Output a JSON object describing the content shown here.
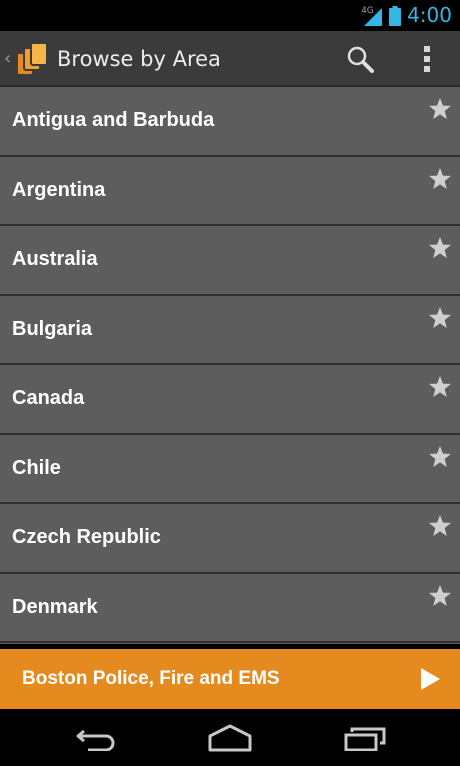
{
  "status_bar": {
    "network_type": "4G",
    "time": "4:00",
    "signal_icon": "signal-icon",
    "battery_icon": "battery-icon"
  },
  "action_bar": {
    "up_icon": "back-caret-icon",
    "app_icon": "app-logo-icon",
    "title": "Browse by Area",
    "search_icon": "search-icon",
    "overflow_icon": "overflow-menu-icon"
  },
  "area_list": {
    "items": [
      {
        "label": "Antigua and Barbuda",
        "favorite_icon": "star-icon"
      },
      {
        "label": "Argentina",
        "favorite_icon": "star-icon"
      },
      {
        "label": "Australia",
        "favorite_icon": "star-icon"
      },
      {
        "label": "Bulgaria",
        "favorite_icon": "star-icon"
      },
      {
        "label": "Canada",
        "favorite_icon": "star-icon"
      },
      {
        "label": "Chile",
        "favorite_icon": "star-icon"
      },
      {
        "label": "Czech Republic",
        "favorite_icon": "star-icon"
      },
      {
        "label": "Denmark",
        "favorite_icon": "star-icon"
      }
    ]
  },
  "now_playing": {
    "title": "Boston Police, Fire and EMS",
    "play_icon": "play-icon"
  },
  "nav_bar": {
    "back_icon": "back-icon",
    "home_icon": "home-icon",
    "recents_icon": "recent-apps-icon"
  },
  "colors": {
    "accent_orange": "#e58a1f",
    "clock_blue": "#33b5e5",
    "list_background": "#5d5d5d",
    "action_bar": "#3b3b3b"
  }
}
